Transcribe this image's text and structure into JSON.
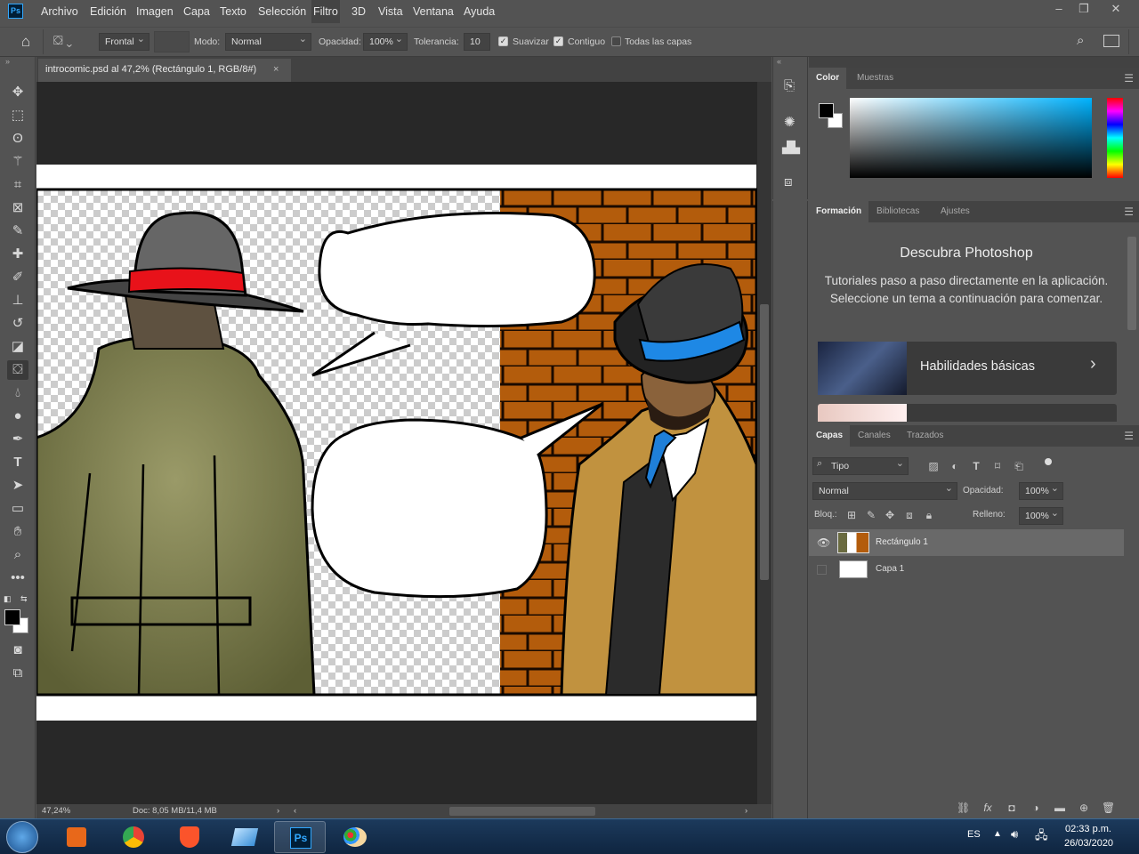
{
  "app": {
    "logo": "Ps"
  },
  "menu": [
    "Archivo",
    "Edición",
    "Imagen",
    "Capa",
    "Texto",
    "Selección",
    "Filtro",
    "3D",
    "Vista",
    "Ventana",
    "Ayuda"
  ],
  "options": {
    "fill_source": "Frontal",
    "mode_label": "Modo:",
    "mode_value": "Normal",
    "opacity_label": "Opacidad:",
    "opacity_value": "100%",
    "tolerance_label": "Tolerancia:",
    "tolerance_value": "10",
    "smooth": "Suavizar",
    "contiguous": "Contiguo",
    "all_layers": "Todas las capas"
  },
  "document": {
    "tab_title": "introcomic.psd al 47,2% (Rectángulo 1, RGB/8#)",
    "zoom": "47,24%",
    "doc_size": "Doc: 8,05 MB/11,4 MB"
  },
  "color_panel": {
    "tabs": [
      "Color",
      "Muestras"
    ]
  },
  "learn_panel": {
    "tabs": [
      "Formación",
      "Bibliotecas",
      "Ajustes"
    ],
    "title": "Descubra Photoshop",
    "description": "Tutoriales paso a paso directamente en la aplicación. Seleccione un tema a continuación para comenzar.",
    "card_label": "Habilidades básicas"
  },
  "layers_panel": {
    "tabs": [
      "Capas",
      "Canales",
      "Trazados"
    ],
    "filter": "Tipo",
    "blend_mode": "Normal",
    "opacity_label": "Opacidad:",
    "opacity_value": "100%",
    "lock_label": "Bloq.:",
    "fill_label": "Relleno:",
    "fill_value": "100%",
    "layers": [
      {
        "name": "Rectángulo 1",
        "visible": true,
        "selected": true
      },
      {
        "name": "Capa 1",
        "visible": false,
        "selected": false
      }
    ]
  },
  "taskbar": {
    "language": "ES",
    "time": "02:33 p.m.",
    "date": "26/03/2020"
  },
  "colors": {
    "accent": "#31a8ff",
    "foreground": "#000000",
    "background": "#ffffff"
  }
}
